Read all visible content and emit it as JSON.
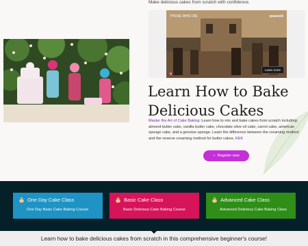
{
  "hero": {
    "tagline": "Make delicious cakes from scratch with confidence.",
    "heading": "Learn How to Bake Delicious Cakes",
    "description_link": "Master the Art of Cake Baking",
    "description_text": ": Learn how to mix and bake cakes from scratch including: almond butter cake, vanilla butter cake, chocolate olive oil cake, carrot cake, american sponge cake, and a genoise sponge. Learn the difference between the creaming method and the reverse creaming method for butter cakes.",
    "description_tail": "KEK",
    "register_label": "Register now"
  },
  "video": {
    "title_overlay": "THOSE WHO DIE",
    "channel_logo": "peacock",
    "learn_more": "Learn more",
    "mute_icon": "volume-mute-icon"
  },
  "classes": [
    {
      "title": "One Day Cake Class",
      "subtitle": "One Day Basic Cake Baking Course",
      "color": "#1e93c4",
      "icon": "cake-icon"
    },
    {
      "title": "Basic Cake Class",
      "subtitle": "Basic Delicious Cake Baking Course",
      "color": "#d6145a",
      "icon": "cake-icon"
    },
    {
      "title": "Advanced Cake Class",
      "subtitle": "Advanced Delicious Cake Baking Class",
      "color": "#2f8e18",
      "icon": "cake-icon"
    }
  ],
  "footer_banner": {
    "text": "Learn how to bake delicious cakes from scratch in this comprehensive beginner's course!"
  },
  "colors": {
    "accent_purple": "#c52fd8",
    "band_background": "#06202a",
    "link": "#6a28b8"
  }
}
